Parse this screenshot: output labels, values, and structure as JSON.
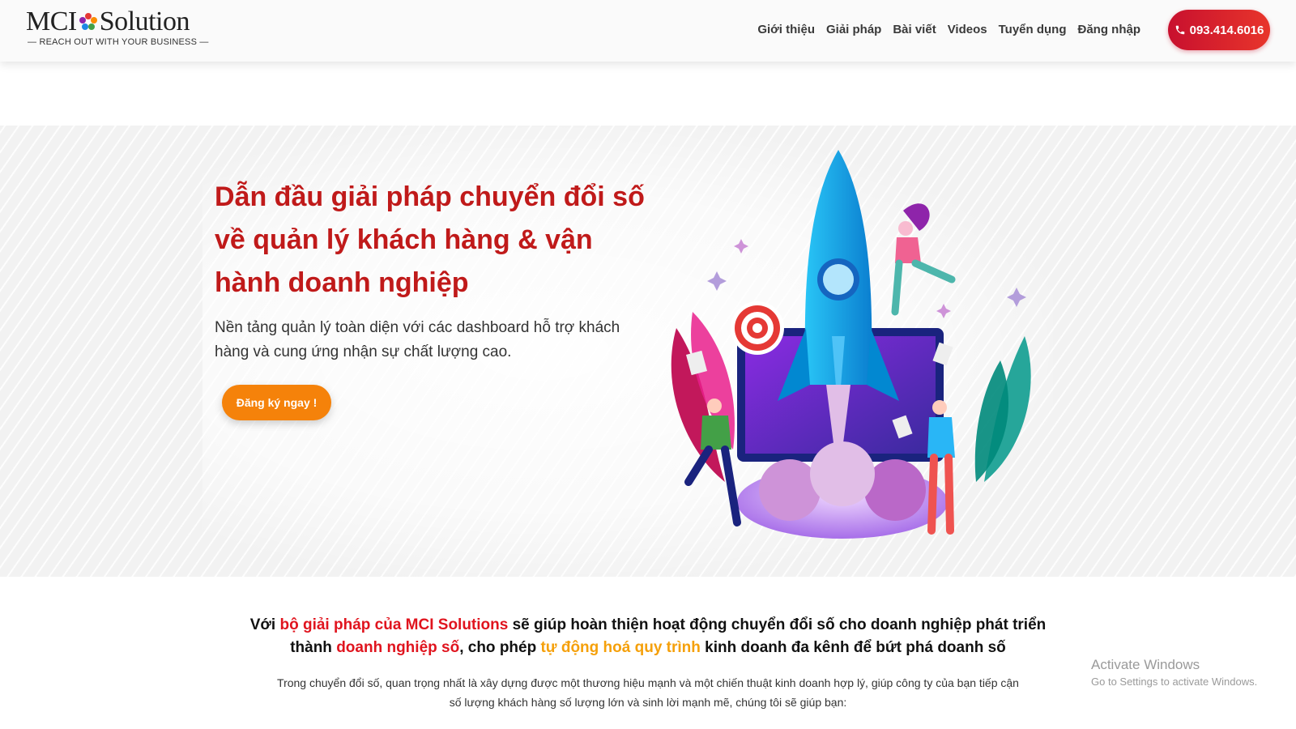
{
  "header": {
    "logo_text": "MCI Solution",
    "logo_tagline": "— REACH OUT WITH YOUR BUSINESS —",
    "nav": [
      {
        "label": "Giới thiệu"
      },
      {
        "label": "Giải pháp"
      },
      {
        "label": "Bài viết"
      },
      {
        "label": "Videos"
      },
      {
        "label": "Tuyển dụng"
      },
      {
        "label": "Đăng nhập"
      }
    ],
    "phone": "093.414.6016"
  },
  "hero": {
    "title": "Dẫn đầu giải pháp chuyển đổi số về quản lý khách hàng & vận hành doanh nghiệp",
    "subtitle": "Nền tảng quản lý toàn diện với các dashboard hỗ trợ khách hàng và cung ứng nhận sự chất lượng cao.",
    "cta_label": "Đăng ký ngay !"
  },
  "intro": {
    "p1": "Với ",
    "p2": "bộ giải pháp của MCI Solutions",
    "p3": " sẽ giúp hoàn thiện hoạt động chuyển đổi số cho doanh nghiệp phát triển thành ",
    "p4": "doanh nghiệp số",
    "p5": ", cho phép ",
    "p6": "tự động hoá quy trình",
    "p7": " kinh doanh đa kênh để bứt phá doanh số",
    "body": "Trong chuyển đổi số, quan trọng nhất là xây dựng được một thương hiệu mạnh và một chiến thuật kinh doanh hợp lý, giúp công ty của bạn tiếp cận số lượng khách hàng số lượng lớn và sinh lời mạnh mẽ, chúng tôi sẽ giúp bạn:"
  },
  "watermark": {
    "title": "Activate Windows",
    "subtitle": "Go to Settings to activate Windows."
  },
  "colors": {
    "brand_red": "#c01a1a",
    "cta_orange": "#f5820a",
    "accent_orange": "#f5a00a"
  }
}
